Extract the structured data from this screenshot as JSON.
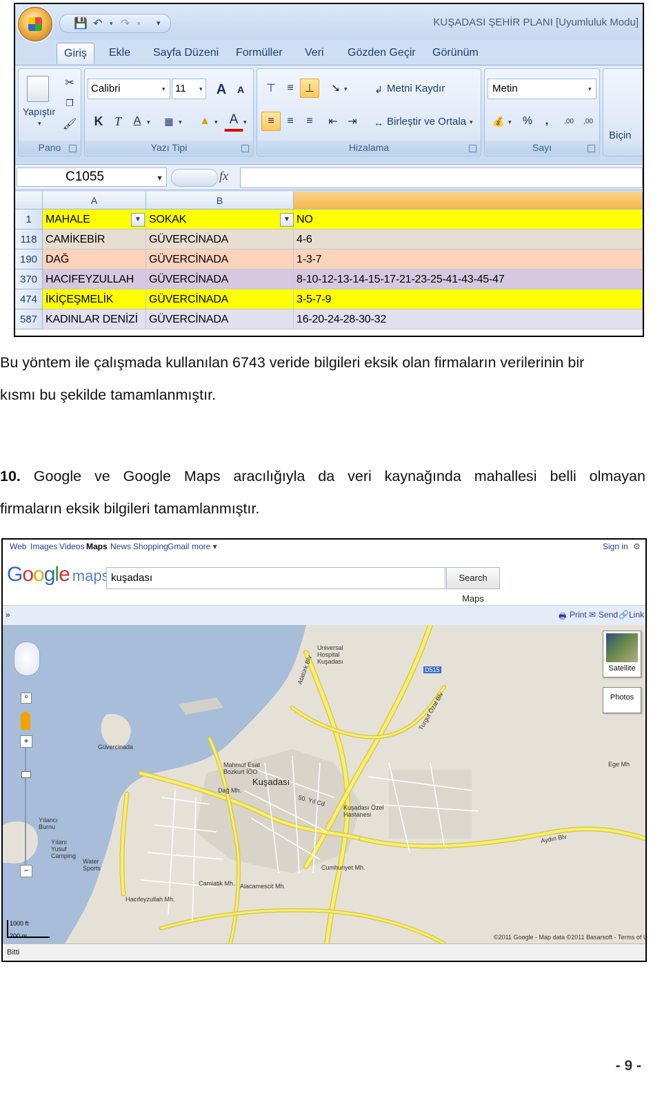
{
  "excel": {
    "window_title": "KUŞADASI ŞEHİR PLANI  [Uyumluluk Modu]",
    "tabs": [
      "Giriş",
      "Ekle",
      "Sayfa Düzeni",
      "Formüller",
      "Veri",
      "Gözden Geçir",
      "Görünüm"
    ],
    "ribbon": {
      "pano_label": "Pano",
      "paste_label": "Yapıştır",
      "yazi_tipi_label": "Yazı Tipi",
      "font_name": "Calibri",
      "font_size": "11",
      "bold": "K",
      "italic": "T",
      "underline": "A",
      "hizalama_label": "Hizalama",
      "wrap_text": "Metni Kaydır",
      "merge_center": "Birleştir ve Ortala",
      "sayi_label": "Sayı",
      "number_format": "Metin",
      "percent": "%",
      "comma": ",",
      "dec_increase": ",00",
      "dec_decrease": ",00",
      "bicim_cut": "Biçin"
    },
    "name_box": "C1055",
    "fx": "fx",
    "columns": [
      "A",
      "B"
    ],
    "header_row": {
      "num": "1",
      "a": "MAHALE",
      "b": "SOKAK",
      "c": "NO"
    },
    "rows": [
      {
        "num": "118",
        "a": "CAMİKEBİR",
        "b": "GÜVERCİNADA",
        "c": "4-6",
        "color": "#e7ded1"
      },
      {
        "num": "190",
        "a": "DAĞ",
        "b": "GÜVERCİNADA",
        "c": "1-3-7",
        "color": "#fbd3bb"
      },
      {
        "num": "370",
        "a": "HACIFEYZULLAH",
        "b": "GÜVERCİNADA",
        "c": "8-10-12-13-14-15-17-21-23-25-41-43-45-47",
        "color": "#d6c8e0"
      },
      {
        "num": "474",
        "a": "İKİÇEŞMELİK",
        "b": "GÜVERCİNADA",
        "c": "3-5-7-9",
        "color": "#ffff00"
      },
      {
        "num": "587",
        "a": "KADINLAR DENİZİ",
        "b": "GÜVERCİNADA",
        "c": "16-20-24-28-30-32",
        "color": "#e2dff0"
      }
    ],
    "header_color": "#ffff00"
  },
  "text": {
    "p1_line1": "Bu yöntem ile çalışmada kullanılan 6743 veride bilgileri eksik olan firmaların verilerinin bir",
    "p1_line2": "kısmı bu şekilde tamamlanmıştır.",
    "p2_num": "10.",
    "p2_words": [
      "Google",
      "ve",
      "Google",
      "Maps",
      "aracılığıyla",
      "da",
      "veri",
      "kaynağında",
      "mahallesi",
      "belli",
      "olmayan"
    ],
    "p2_line2": "firmaların eksik bilgileri tamamlanmıştır.",
    "page_number": "- 9 -"
  },
  "maps": {
    "gbar": [
      "Web",
      "Images",
      "Videos",
      "Maps",
      "News",
      "Shopping",
      "Gmail",
      "more ▾"
    ],
    "sign_in": "Sign in",
    "logo_google": "Google",
    "logo_maps": "maps",
    "search_value": "kuşadası",
    "search_button": "Search Maps",
    "toolbar": {
      "print": "Print",
      "send": "Send",
      "link": "Link"
    },
    "map_type": {
      "satellite": "Satellite",
      "photos": "Photos"
    },
    "scale": {
      "ft": "1000 ft",
      "m": "200 m"
    },
    "copyright": "©2011 Google - Map data ©2011 Basarsoft - Terms of Use",
    "status": "Bitti",
    "labels": {
      "kusadasi": "Kuşadası",
      "guvercinada": "Güvercinada",
      "universal": "Universal Hospital Kuşadası",
      "dag": "Dağ Mh.",
      "cumhuriyet": "Cumhuriyet Mh.",
      "camiatik": "Camiatik Mh.",
      "alacamescit": "Alacamescit Mh.",
      "hacifeyzullah": "Hacıfeyzullah Mh.",
      "ege": "Ege Mh",
      "turgut": "Turgut Özal Blv",
      "ataturk": "Atatürk Blv",
      "guzel": "Kuşadası Özel Hastanesi",
      "yilanci": "Yılancı Burnu",
      "yaykamp": "Yılanı Yusuf Camping",
      "water": "Water Sports",
      "mahmut": "Mahmut Esat Bozkurt İÖO",
      "yeniyol": "50. Yıl Cd",
      "aydin": "Aydın Blv",
      "d515": "D515"
    },
    "colors": {
      "sea": "#a7bdd9",
      "land": "#e6e1d7",
      "road": "#f7ef70",
      "road_edge": "#d8c94a"
    }
  }
}
